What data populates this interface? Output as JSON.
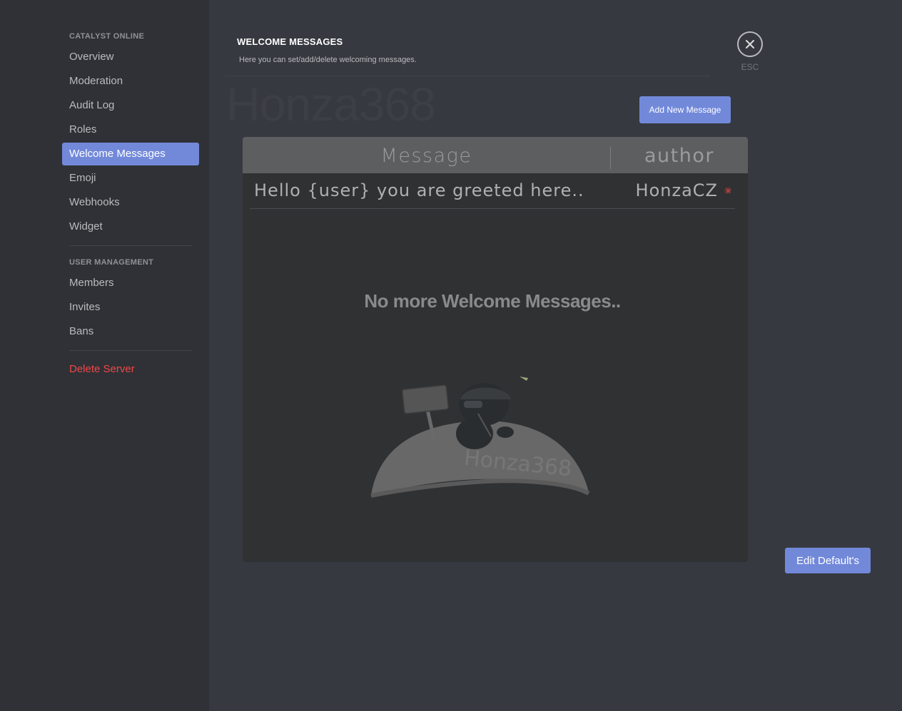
{
  "sidebar": {
    "header_server": "CATALYST ONLINE",
    "server_items": [
      {
        "label": "Overview"
      },
      {
        "label": "Moderation"
      },
      {
        "label": "Audit Log"
      },
      {
        "label": "Roles"
      },
      {
        "label": "Welcome Messages"
      },
      {
        "label": "Emoji"
      },
      {
        "label": "Webhooks"
      },
      {
        "label": "Widget"
      }
    ],
    "selected": "Welcome Messages",
    "header_users": "USER MANAGEMENT",
    "user_items": [
      {
        "label": "Members"
      },
      {
        "label": "Invites"
      },
      {
        "label": "Bans"
      }
    ],
    "delete_label": "Delete Server"
  },
  "page": {
    "title": "WELCOME MESSAGES",
    "description": "Here you can set/add/delete welcoming messages.",
    "watermark": "Honza368",
    "close_label": "ESC",
    "add_button": "Add New Message",
    "edit_button": "Edit Default's"
  },
  "table": {
    "columns": [
      "Message",
      "author"
    ],
    "rows": [
      {
        "message": "Hello {user} you are greeted here..",
        "author": "HonzaCZ"
      }
    ],
    "empty_text": "No more Welcome Messages..",
    "illustration_watermark": "Honza368"
  },
  "colors": {
    "accent": "#7289da",
    "danger": "#f04747",
    "sidebar_bg": "#2f3136",
    "content_bg": "#36393f"
  },
  "icons": {
    "close": "close-icon",
    "delete_row": "delete-icon"
  }
}
